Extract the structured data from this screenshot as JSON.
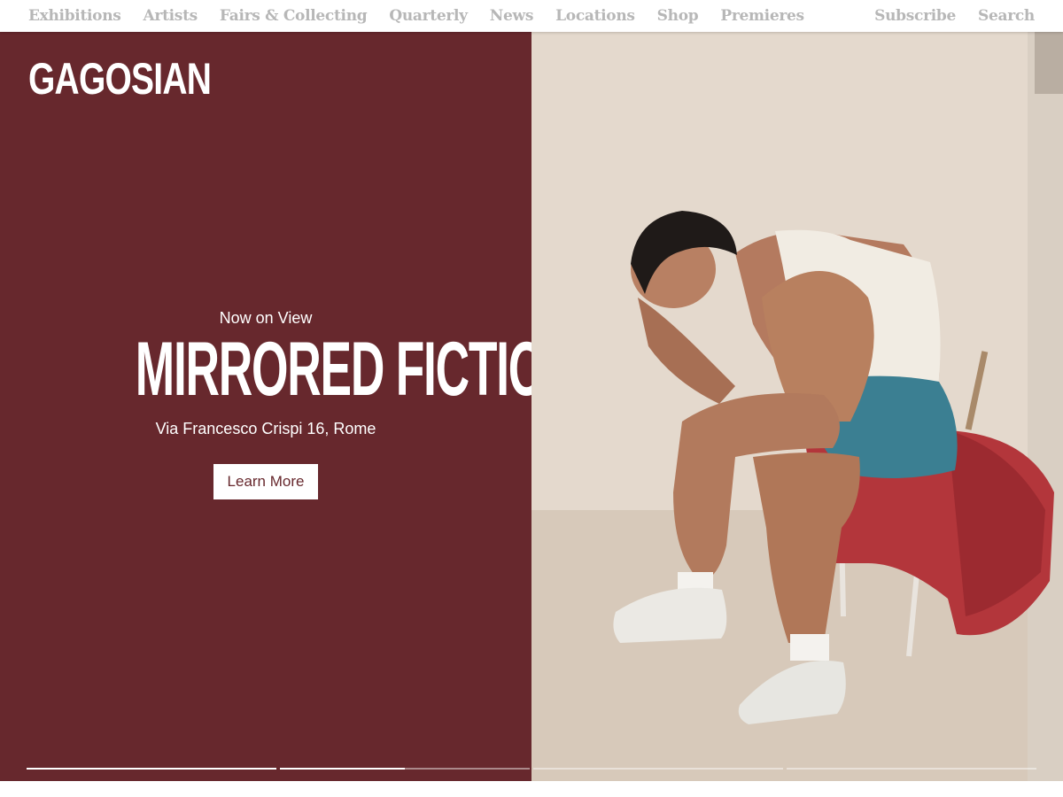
{
  "nav": {
    "left": [
      "Exhibitions",
      "Artists",
      "Fairs & Collecting",
      "Quarterly",
      "News",
      "Locations",
      "Shop",
      "Premieres"
    ],
    "right": [
      "Subscribe",
      "Search"
    ]
  },
  "hero": {
    "logo": "GAGOSIAN",
    "eyebrow": "Now on View",
    "title": "MIRRORED FICTION",
    "address": "Via Francesco Crispi 16, Rome",
    "cta_label": "Learn More",
    "image_icon": "photo-seated-man",
    "colors": {
      "panel": "#67282d",
      "nav_text": "#b7b7b7",
      "text": "#ffffff"
    }
  },
  "slider": {
    "slides": 4,
    "active_index": 1,
    "active_progress": 0.5
  }
}
